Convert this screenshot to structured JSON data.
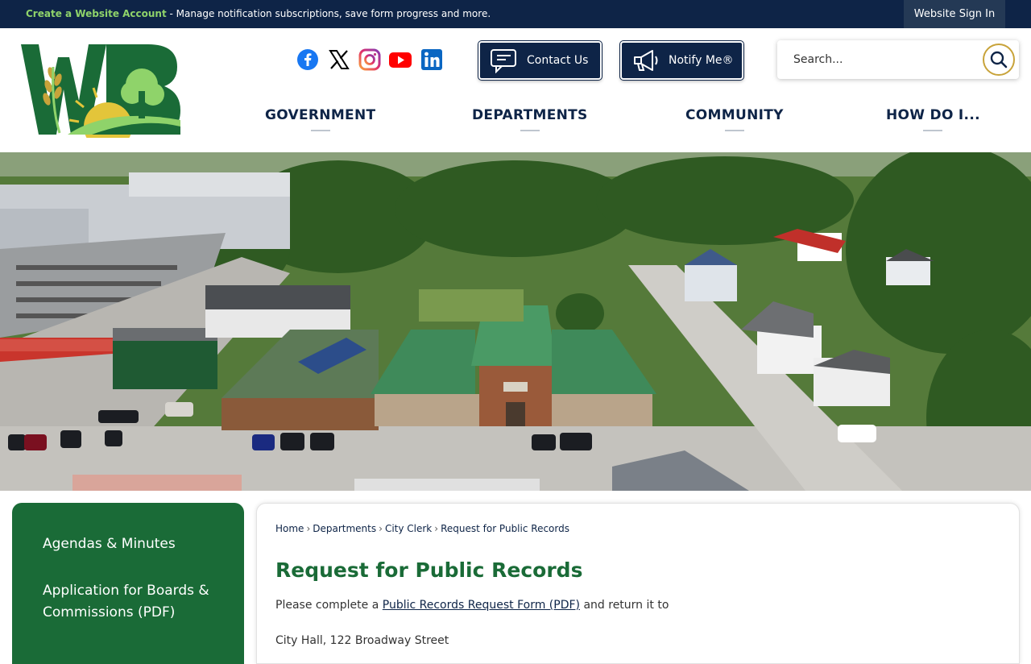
{
  "topbar": {
    "create_link": "Create a Website Account",
    "message": " - Manage notification subscriptions, save form progress and more.",
    "signin_label": "Website Sign In"
  },
  "header": {
    "logo_text": "WB",
    "social": [
      "facebook-icon",
      "x-icon",
      "instagram-icon",
      "youtube-icon",
      "linkedin-icon"
    ],
    "contact_label": "Contact Us",
    "notify_label": "Notify Me®",
    "search_placeholder": "Search..."
  },
  "nav": {
    "items": [
      "GOVERNMENT",
      "DEPARTMENTS",
      "COMMUNITY",
      "HOW DO I..."
    ]
  },
  "sidebar": {
    "items": [
      "Agendas & Minutes",
      "Application for Boards & Commissions (PDF)"
    ]
  },
  "content": {
    "breadcrumb": [
      "Home",
      "Departments",
      "City Clerk",
      "Request for Public Records"
    ],
    "title": "Request for Public Records",
    "para_prefix": "Please complete a ",
    "para_link": "Public Records Request Form (PDF)",
    "para_suffix": " and return it to",
    "address": "City Hall, 122 Broadway Street"
  },
  "colors": {
    "navy": "#0e2447",
    "green": "#1a6b37",
    "accent_green": "#8fd36a",
    "gold": "#c8a33a"
  }
}
